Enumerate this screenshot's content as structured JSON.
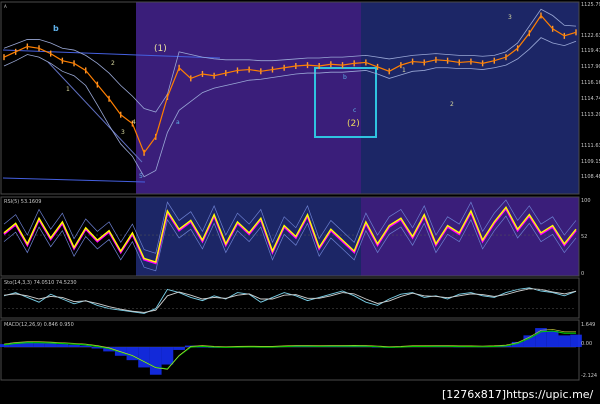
{
  "watermark": "[1276x817]https://upic.me/",
  "chart_data": [
    {
      "type": "line",
      "panel": "price",
      "title": "",
      "xlabel": "",
      "ylabel": "",
      "ylim": [
        1106.0,
        1127.0
      ],
      "y_ticks": [
        "1125.79",
        "1122.63",
        "1119.47",
        "1117.90",
        "1116.16",
        "1114.74",
        "1113.20",
        "1111.63",
        "1109.15",
        "1108.48"
      ],
      "x": [
        0,
        6,
        12,
        18,
        24,
        30,
        36,
        42,
        48,
        54,
        60,
        66,
        72,
        78,
        84,
        90,
        96,
        102,
        108,
        114,
        120,
        126,
        132,
        138,
        144,
        150,
        156,
        162,
        168,
        174,
        180,
        186,
        192,
        198,
        204,
        210,
        216,
        222,
        228,
        234,
        240,
        246,
        252,
        258,
        264,
        270,
        276,
        282,
        288,
        294
      ],
      "series": [
        {
          "values": [
            1121.0,
            1121.6,
            1122.2,
            1122.0,
            1121.4,
            1120.6,
            1120.3,
            1119.5,
            1117.9,
            1116.3,
            1114.5,
            1113.5,
            1110.2,
            1112.0,
            1116.5,
            1119.8,
            1118.6,
            1119.1,
            1118.9,
            1119.2,
            1119.5,
            1119.6,
            1119.4,
            1119.6,
            1119.8,
            1120.0,
            1120.1,
            1120.0,
            1120.2,
            1120.1,
            1120.3,
            1120.4,
            1119.9,
            1119.4,
            1120.1,
            1120.5,
            1120.4,
            1120.7,
            1120.6,
            1120.4,
            1120.5,
            1120.3,
            1120.6,
            1121.0,
            1122.0,
            1123.7,
            1125.7,
            1124.2,
            1123.4,
            1123.8
          ]
        },
        {
          "values": [
            1122.0,
            1122.5,
            1123.0,
            1123.0,
            1122.6,
            1122.0,
            1121.8,
            1121.2,
            1120.3,
            1119.2,
            1117.8,
            1116.6,
            1115.2,
            1114.8,
            1116.8,
            1121.6,
            1121.3,
            1121.0,
            1120.8,
            1120.7,
            1120.7,
            1120.7,
            1120.6,
            1120.6,
            1120.7,
            1120.8,
            1120.9,
            1120.9,
            1121.0,
            1121.0,
            1121.1,
            1121.2,
            1121.0,
            1120.8,
            1121.0,
            1121.2,
            1121.3,
            1121.4,
            1121.3,
            1121.2,
            1121.2,
            1121.1,
            1121.2,
            1121.6,
            1122.6,
            1124.5,
            1126.4,
            1125.7,
            1124.6,
            1124.5
          ]
        },
        {
          "values": [
            1120.0,
            1120.6,
            1121.3,
            1121.0,
            1120.3,
            1119.4,
            1118.9,
            1117.8,
            1115.6,
            1113.3,
            1111.2,
            1109.8,
            1107.5,
            1108.2,
            1112.5,
            1115.0,
            1116.0,
            1117.0,
            1117.5,
            1117.8,
            1118.1,
            1118.4,
            1118.5,
            1118.7,
            1118.9,
            1119.1,
            1119.2,
            1119.2,
            1119.3,
            1119.3,
            1119.4,
            1119.5,
            1119.1,
            1118.6,
            1119.0,
            1119.4,
            1119.5,
            1119.8,
            1119.8,
            1119.7,
            1119.7,
            1119.6,
            1119.8,
            1120.1,
            1120.8,
            1121.9,
            1123.2,
            1122.6,
            1122.3,
            1122.8
          ]
        }
      ]
    },
    {
      "type": "line",
      "panel": "rsi",
      "title": "RSI(5) 53.1609",
      "ylim": [
        0,
        100
      ],
      "y_ticks": [
        "100",
        "52",
        "0"
      ],
      "series": [
        {
          "values": [
            55,
            68,
            40,
            75,
            48,
            70,
            35,
            62,
            45,
            58,
            30,
            55,
            20,
            15,
            85,
            60,
            72,
            45,
            80,
            40,
            70,
            55,
            75,
            30,
            65,
            50,
            80,
            35,
            60,
            45,
            30,
            70,
            40,
            65,
            75,
            50,
            80,
            40,
            65,
            55,
            85,
            45,
            70,
            90,
            60,
            80,
            55,
            65,
            40,
            60
          ]
        }
      ]
    },
    {
      "type": "line",
      "panel": "stochastic",
      "title": "Sto(14,3,3) 74.0510 74.5230",
      "ylim": [
        0,
        100
      ],
      "series": [
        {
          "values": [
            60,
            70,
            55,
            40,
            65,
            50,
            35,
            45,
            30,
            20,
            15,
            10,
            5,
            20,
            80,
            70,
            55,
            45,
            60,
            50,
            70,
            65,
            40,
            55,
            70,
            60,
            45,
            55,
            65,
            75,
            60,
            40,
            30,
            50,
            65,
            70,
            55,
            60,
            50,
            65,
            70,
            60,
            55,
            70,
            80,
            85,
            75,
            70,
            60,
            74
          ]
        },
        {
          "values": [
            62,
            66,
            60,
            50,
            58,
            55,
            42,
            44,
            36,
            26,
            18,
            12,
            8,
            15,
            60,
            72,
            62,
            50,
            55,
            52,
            62,
            66,
            50,
            50,
            62,
            64,
            52,
            52,
            60,
            70,
            66,
            50,
            36,
            44,
            58,
            68,
            60,
            58,
            54,
            60,
            66,
            64,
            58,
            64,
            74,
            82,
            80,
            72,
            66,
            74.5
          ]
        }
      ]
    },
    {
      "type": "bar",
      "panel": "macd",
      "title": "MACD(12,26,9) 0.846 0.950",
      "y_ticks": [
        "1.649",
        "0.00",
        "-2.124"
      ],
      "ylim": [
        -2.124,
        1.649
      ],
      "histogram": [
        0.2,
        0.3,
        0.35,
        0.3,
        0.25,
        0.2,
        0.15,
        0.1,
        -0.1,
        -0.3,
        -0.6,
        -0.9,
        -1.4,
        -1.9,
        -1.2,
        -0.2,
        0.1,
        0.0,
        -0.05,
        -0.02,
        0.0,
        0.02,
        -0.01,
        0.0,
        0.05,
        0.08,
        0.06,
        0.05,
        0.07,
        0.06,
        0.08,
        0.05,
        0.0,
        -0.05,
        0.02,
        0.05,
        0.04,
        0.06,
        0.05,
        0.02,
        0.03,
        0.02,
        0.05,
        0.1,
        0.35,
        0.8,
        1.3,
        1.1,
        0.8,
        0.85
      ],
      "signal": [
        0.15,
        0.25,
        0.3,
        0.3,
        0.28,
        0.24,
        0.2,
        0.15,
        0.05,
        -0.1,
        -0.35,
        -0.6,
        -1.0,
        -1.4,
        -1.5,
        -0.6,
        0.0,
        0.05,
        0.0,
        -0.02,
        0.0,
        0.01,
        0.0,
        0.0,
        0.03,
        0.06,
        0.06,
        0.05,
        0.06,
        0.06,
        0.07,
        0.06,
        0.02,
        -0.02,
        0.0,
        0.04,
        0.04,
        0.05,
        0.05,
        0.03,
        0.03,
        0.02,
        0.04,
        0.08,
        0.25,
        0.6,
        1.05,
        1.1,
        0.95,
        0.95
      ]
    }
  ],
  "annotations": {
    "wave_b_top": "b",
    "wave_1_marker": "(1)",
    "wave_2_marker": "(2)",
    "wave_labels": [
      "1",
      "2",
      "3",
      "4",
      "5",
      "a",
      "b",
      "c",
      "1",
      "2",
      "3"
    ],
    "top_left_small": "A"
  },
  "colors": {
    "price_line": "#ff7f00",
    "band": "#9aa8d6",
    "rsi": "#ffff00",
    "rsi_alt": "#ff00ff",
    "macd_hist": "#1530ff",
    "macd_signal": "#00cc00",
    "purple_zone": "#3a1e7a",
    "blue_zone": "#1c2666",
    "box": "#2fc3e0",
    "wave_label": "#d8d8a0",
    "wave_alt": "#5fb0e8"
  }
}
